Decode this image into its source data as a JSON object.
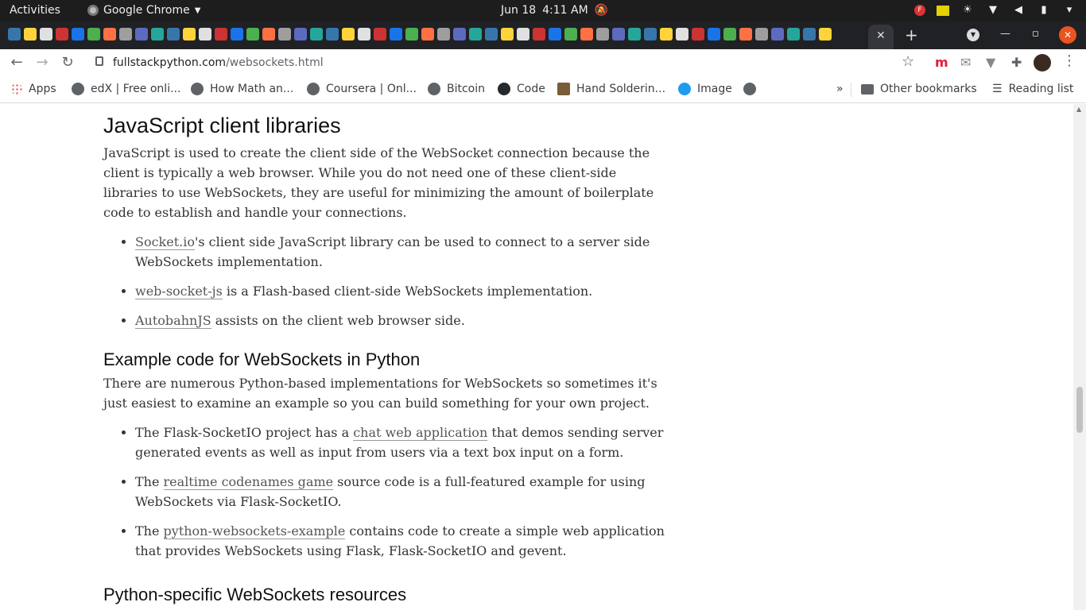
{
  "system": {
    "activities": "Activities",
    "app_name": "Google Chrome",
    "date": "Jun 18",
    "time": "4:11 AM"
  },
  "browser": {
    "url_domain": "fullstackpython.com",
    "url_path": "/websockets.html",
    "active_tab_close": "✕",
    "new_tab": "+"
  },
  "bookmarks": {
    "apps": "Apps",
    "items": [
      "edX | Free onli...",
      "How Math an...",
      "Coursera | Onl...",
      "Bitcoin",
      "Code",
      "Hand Solderin...",
      "Image"
    ],
    "overflow": "»",
    "other": "Other bookmarks",
    "reading_list": "Reading list"
  },
  "article": {
    "h1": "JavaScript client libraries",
    "p1": "JavaScript is used to create the client side of the WebSocket connection because the client is typically a web browser. While you do not need one of these client-side libraries to use WebSockets, they are useful for minimizing the amount of boilerplate code to establish and handle your connections.",
    "list1": [
      {
        "link": "Socket.io",
        "text": "'s client side JavaScript library can be used to connect to a server side WebSockets implementation."
      },
      {
        "link": "web-socket-js",
        "text": " is a Flash-based client-side WebSockets implementation."
      },
      {
        "link": "AutobahnJS",
        "text": " assists on the client web browser side."
      }
    ],
    "h2": "Example code for WebSockets in Python",
    "p2": "There are numerous Python-based implementations for WebSockets so sometimes it's just easiest to examine an example so you can build something for your own project.",
    "list2": [
      {
        "pre": "The Flask-SocketIO project has a ",
        "link": "chat web application",
        "text": " that demos sending server generated events as well as input from users via a text box input on a form."
      },
      {
        "pre": "The ",
        "link": "realtime codenames game",
        "text": " source code is a full-featured example for using WebSockets via Flask-SocketIO."
      },
      {
        "pre": "The ",
        "link": "python-websockets-example",
        "text": " contains code to create a simple web application that provides WebSockets using Flask, Flask-SocketIO and gevent."
      }
    ],
    "h3": "Python-specific WebSockets resources"
  }
}
